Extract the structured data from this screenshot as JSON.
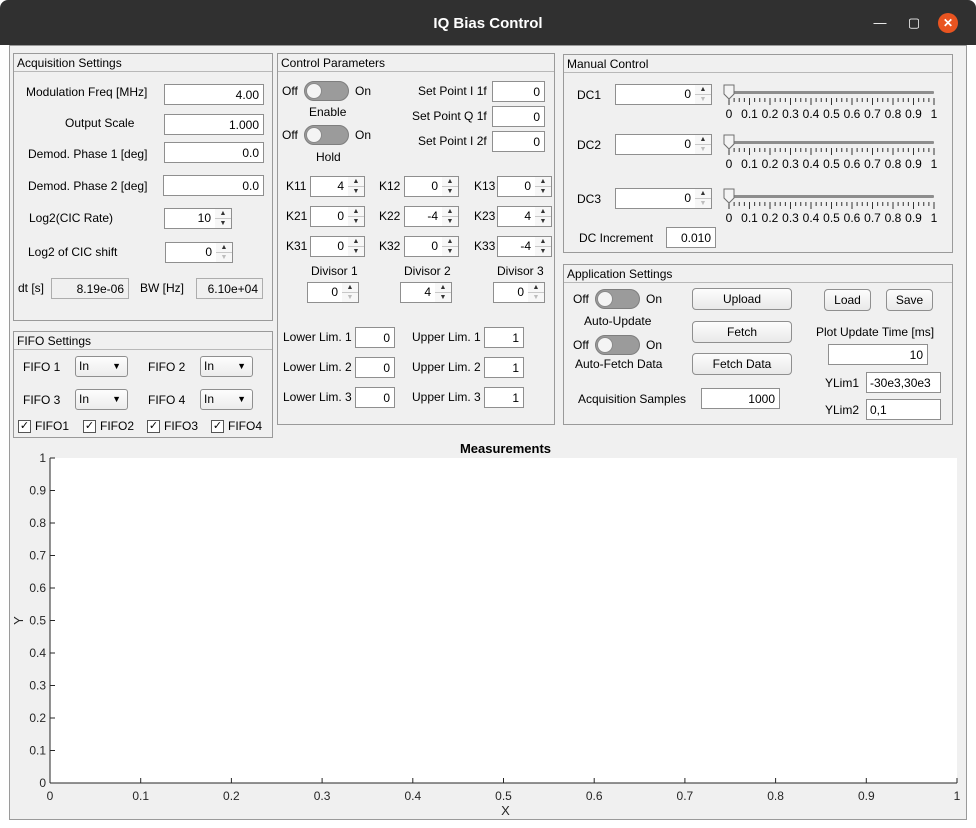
{
  "window": {
    "title": "IQ Bias Control"
  },
  "acq": {
    "title": "Acquisition Settings",
    "mod_freq_label": "Modulation Freq [MHz]",
    "mod_freq": "4.00",
    "output_scale_label": "Output Scale",
    "output_scale": "1.000",
    "phase1_label": "Demod. Phase 1 [deg]",
    "phase1": "0.0",
    "phase2_label": "Demod. Phase 2 [deg]",
    "phase2": "0.0",
    "cic_rate_label": "Log2(CIC Rate)",
    "cic_rate": "10",
    "cic_shift_label": "Log2 of CIC shift",
    "cic_shift": "0",
    "dt_label": "dt [s]",
    "dt": "8.19e-06",
    "bw_label": "BW [Hz]",
    "bw": "6.10e+04"
  },
  "fifo": {
    "title": "FIFO Settings",
    "f1_label": "FIFO 1",
    "f1": "In",
    "f2_label": "FIFO 2",
    "f2": "In",
    "f3_label": "FIFO 3",
    "f3": "In",
    "f4_label": "FIFO 4",
    "f4": "In",
    "cb1": "FIFO1",
    "cb2": "FIFO2",
    "cb3": "FIFO3",
    "cb4": "FIFO4",
    "check": "✓"
  },
  "ctrl": {
    "title": "Control Parameters",
    "off": "Off",
    "on": "On",
    "enable_label": "Enable",
    "hold_label": "Hold",
    "sp_i1_label": "Set Point I 1f",
    "sp_i1": "0",
    "sp_q1_label": "Set Point Q 1f",
    "sp_q1": "0",
    "sp_i2_label": "Set Point I 2f",
    "sp_i2": "0",
    "k11_label": "K11",
    "k11": "4",
    "k12_label": "K12",
    "k12": "0",
    "k13_label": "K13",
    "k13": "0",
    "k21_label": "K21",
    "k21": "0",
    "k22_label": "K22",
    "k22": "-4",
    "k23_label": "K23",
    "k23": "4",
    "k31_label": "K31",
    "k31": "0",
    "k32_label": "K32",
    "k32": "0",
    "k33_label": "K33",
    "k33": "-4",
    "div1_label": "Divisor 1",
    "div1": "0",
    "div2_label": "Divisor 2",
    "div2": "4",
    "div3_label": "Divisor 3",
    "div3": "0",
    "ll1_label": "Lower Lim. 1",
    "ll1": "0",
    "ll2_label": "Lower Lim. 2",
    "ll2": "0",
    "ll3_label": "Lower Lim. 3",
    "ll3": "0",
    "ul1_label": "Upper Lim. 1",
    "ul1": "1",
    "ul2_label": "Upper Lim. 2",
    "ul2": "1",
    "ul3_label": "Upper Lim. 3",
    "ul3": "1"
  },
  "manual": {
    "title": "Manual Control",
    "dc1_label": "DC1",
    "dc1": "0",
    "dc2_label": "DC2",
    "dc2": "0",
    "dc3_label": "DC3",
    "dc3": "0",
    "slider_ticks": [
      "0",
      "0.1",
      "0.2",
      "0.3",
      "0.4",
      "0.5",
      "0.6",
      "0.7",
      "0.8",
      "0.9",
      "1"
    ],
    "slider_levels": [
      0,
      0,
      0
    ],
    "inc_label": "DC Increment",
    "inc": "0.010"
  },
  "app": {
    "title": "Application Settings",
    "off": "Off",
    "on": "On",
    "auto_update_label": "Auto-Update",
    "auto_fetch_label": "Auto-Fetch Data",
    "upload": "Upload",
    "fetch": "Fetch",
    "fetch_data": "Fetch Data",
    "load": "Load",
    "save": "Save",
    "put_label": "Plot Update Time [ms]",
    "put": "10",
    "ylim1_label": "YLim1",
    "ylim1": "-30e3,30e3",
    "ylim2_label": "YLim2",
    "ylim2": "0,1",
    "samples_label": "Acquisition Samples",
    "samples": "1000"
  },
  "chart_data": {
    "type": "line",
    "title": "Measurements",
    "xlabel": "X",
    "ylabel": "Y",
    "xlim": [
      0,
      1
    ],
    "ylim": [
      0,
      1
    ],
    "xticks": [
      "0",
      "0.1",
      "0.2",
      "0.3",
      "0.4",
      "0.5",
      "0.6",
      "0.7",
      "0.8",
      "0.9",
      "1"
    ],
    "yticks": [
      "0",
      "0.1",
      "0.2",
      "0.3",
      "0.4",
      "0.5",
      "0.6",
      "0.7",
      "0.8",
      "0.9",
      "1"
    ],
    "series": [],
    "grid": false
  }
}
